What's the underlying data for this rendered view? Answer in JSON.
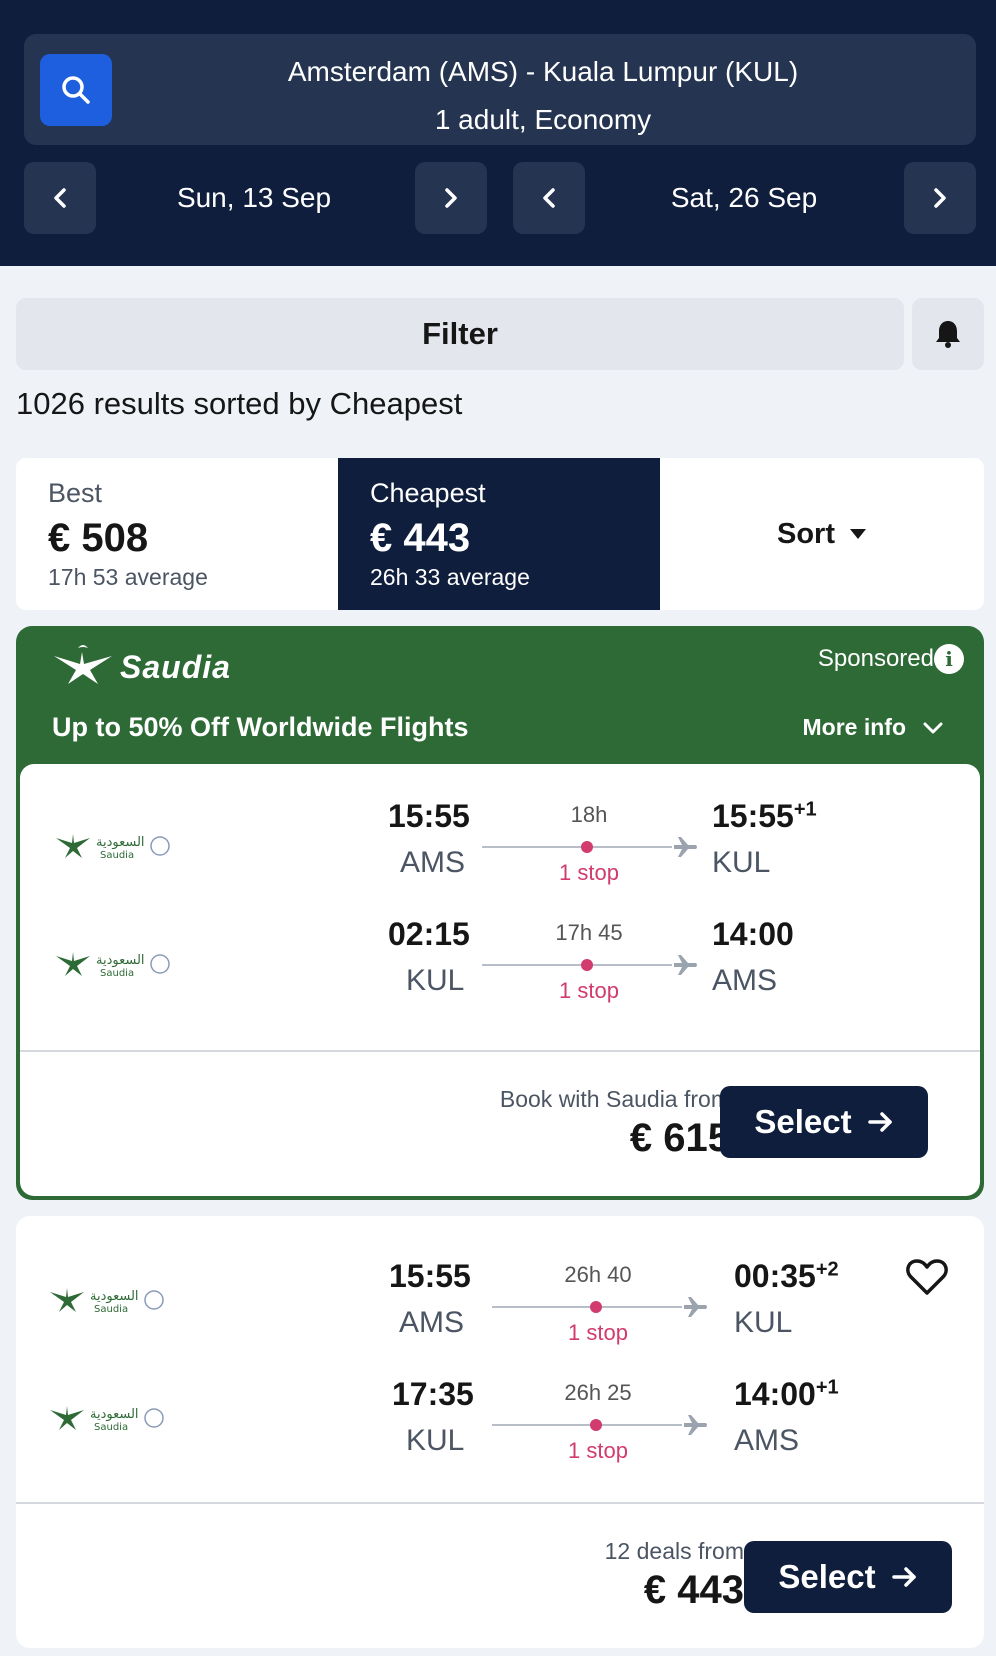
{
  "search": {
    "route": "Amsterdam (AMS) - Kuala Lumpur (KUL)",
    "passengers": "1 adult, Economy",
    "depart_date": "Sun, 13 Sep",
    "return_date": "Sat, 26 Sep"
  },
  "filter": {
    "label": "Filter"
  },
  "results": {
    "summary": "1026 results sorted by Cheapest"
  },
  "sort_tabs": {
    "best": {
      "label": "Best",
      "price": "€ 508",
      "avg": "17h 53 average"
    },
    "cheapest": {
      "label": "Cheapest",
      "price": "€ 443",
      "avg": "26h 33 average"
    },
    "sort": {
      "label": "Sort"
    }
  },
  "sponsored": {
    "brand": "Saudia",
    "label": "Sponsored",
    "promo": "Up to 50% Off Worldwide Flights",
    "more_info": "More info",
    "legs": [
      {
        "depart_time": "15:55",
        "depart_code": "AMS",
        "duration": "18h",
        "stops": "1 stop",
        "arrive_time": "15:55",
        "arrive_offset": "+1",
        "arrive_code": "KUL"
      },
      {
        "depart_time": "02:15",
        "depart_code": "KUL",
        "duration": "17h 45",
        "stops": "1 stop",
        "arrive_time": "14:00",
        "arrive_offset": "",
        "arrive_code": "AMS"
      }
    ],
    "book_text": "Book with Saudia from",
    "price": "€ 615",
    "select": "Select"
  },
  "result1": {
    "legs": [
      {
        "depart_time": "15:55",
        "depart_code": "AMS",
        "duration": "26h 40",
        "stops": "1 stop",
        "arrive_time": "00:35",
        "arrive_offset": "+2",
        "arrive_code": "KUL"
      },
      {
        "depart_time": "17:35",
        "depart_code": "KUL",
        "duration": "26h 25",
        "stops": "1 stop",
        "arrive_time": "14:00",
        "arrive_offset": "+1",
        "arrive_code": "AMS"
      }
    ],
    "deals_text": "12 deals from",
    "price": "€ 443",
    "select": "Select"
  },
  "icons": {
    "search": "search-icon",
    "prev": "chevron-left-icon",
    "next": "chevron-right-icon",
    "bell": "bell-icon",
    "sort_caret": "caret-down-icon",
    "info": "info-icon",
    "more_info_chevron": "chevron-down-icon",
    "plane": "plane-icon",
    "arrow": "arrow-right-icon",
    "heart": "heart-icon"
  },
  "colors": {
    "header": "#0f1e3d",
    "accent_blue": "#1e5fe0",
    "sponsor_green": "#2d6a36",
    "stop_pink": "#d13b6d"
  }
}
